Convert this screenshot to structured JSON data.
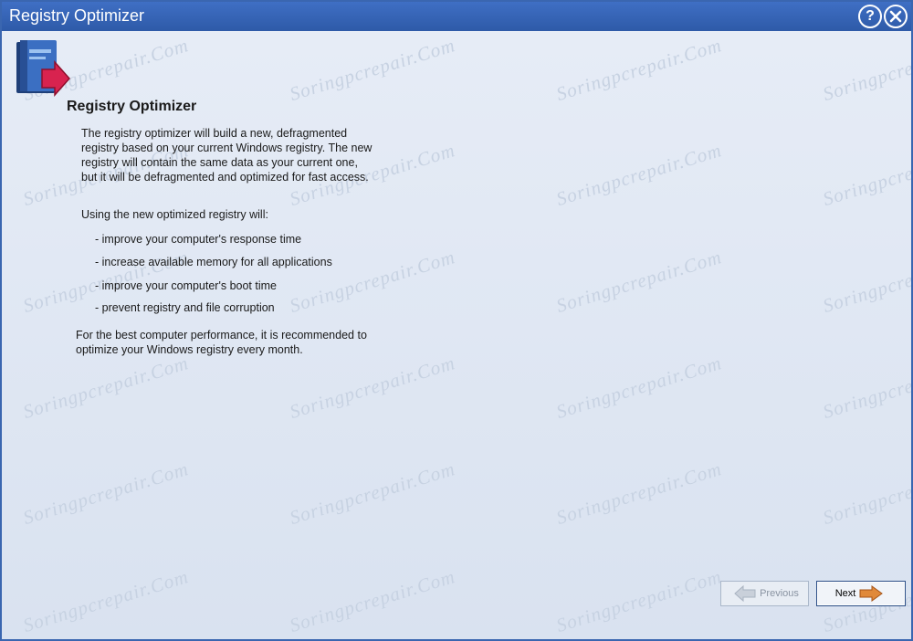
{
  "window": {
    "title": "Registry Optimizer",
    "help_icon": "help-icon",
    "close_icon": "close-icon"
  },
  "content": {
    "logo_icon": "registry-book-icon",
    "heading": "Registry Optimizer",
    "intro_lines": [
      "The registry optimizer will build a new, defragmented",
      "registry based on your current Windows registry. The new",
      "registry will contain the same data as your current one,",
      "but it will be defragmented and optimized for fast access."
    ],
    "benefits_intro": "Using the new optimized registry will:",
    "benefits": [
      "- improve your computer's response time",
      "- increase available memory for all applications",
      "- improve your computer's boot time",
      "- prevent registry and file corruption"
    ],
    "recommendation_lines": [
      "For the best computer performance, it is recommended to",
      "optimize your Windows registry every month."
    ],
    "watermark": "Soringpcrepair.Com"
  },
  "footer": {
    "previous_label": "Previous",
    "previous_enabled": false,
    "next_label": "Next"
  },
  "colors": {
    "title_bar": "#2e5aa8",
    "client_bg": "#dfe7f3",
    "arrow_accent": "#e0893a"
  }
}
